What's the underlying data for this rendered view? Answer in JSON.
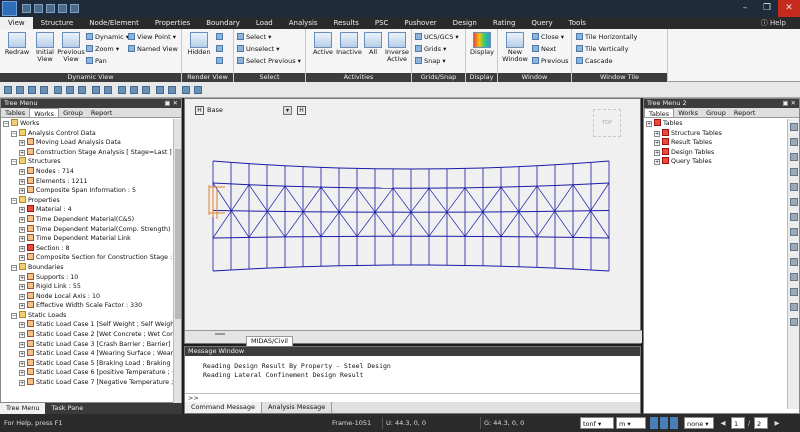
{
  "menu": {
    "tabs": [
      "View",
      "Structure",
      "Node/Element",
      "Properties",
      "Boundary",
      "Load",
      "Analysis",
      "Results",
      "PSC",
      "Pushover",
      "Design",
      "Rating",
      "Query",
      "Tools"
    ],
    "active": "View",
    "help": "Help"
  },
  "ribbon": {
    "dynamic_view": {
      "caption": "Dynamic View",
      "redraw": "Redraw",
      "initial_view": "Initial View",
      "previous_view": "Previous View",
      "dynamic": "Dynamic",
      "zoom": "Zoom",
      "pan": "Pan",
      "view_point": "View Point",
      "named_view": "Named View"
    },
    "render_view": {
      "caption": "Render View",
      "hidden": "Hidden"
    },
    "select": {
      "caption": "Select",
      "select": "Select",
      "unselect": "Unselect",
      "select_previous": "Select Previous"
    },
    "activities": {
      "caption": "Activities",
      "active": "Active",
      "inactive": "Inactive",
      "all": "All",
      "inverse_active": "Inverse Active"
    },
    "grids_snap": {
      "caption": "Grids/Snap",
      "ucs": "UCS/GCS",
      "grids": "Grids",
      "snap": "Snap"
    },
    "display": {
      "caption": "Display",
      "display": "Display"
    },
    "window": {
      "caption": "Window",
      "new_window": "New Window",
      "close": "Close",
      "next": "Next",
      "previous": "Previous"
    },
    "window_tile": {
      "caption": "Window Tile",
      "tile_h": "Tile Horizontally",
      "tile_v": "Tile Vertically",
      "cascade": "Cascade"
    }
  },
  "tree_menu": {
    "title": "Tree Menu",
    "tabs": [
      "Tables",
      "Works",
      "Group",
      "Report"
    ],
    "active_tab": "Works",
    "rows": [
      {
        "d": 0,
        "t": "Works",
        "ic": "fold"
      },
      {
        "d": 1,
        "t": "Analysis Control Data",
        "ic": "fold"
      },
      {
        "d": 2,
        "t": "Moving Load Analysis Data",
        "ic": ""
      },
      {
        "d": 2,
        "t": "Construction Stage Analysis [ Stage=Last ]",
        "ic": ""
      },
      {
        "d": 1,
        "t": "Structures",
        "ic": "fold"
      },
      {
        "d": 2,
        "t": "Nodes : 714",
        "ic": ""
      },
      {
        "d": 2,
        "t": "Elements : 1211",
        "ic": ""
      },
      {
        "d": 2,
        "t": "Composite Span Information : 5",
        "ic": ""
      },
      {
        "d": 1,
        "t": "Properties",
        "ic": "fold"
      },
      {
        "d": 2,
        "t": "Material : 4",
        "ic": "red"
      },
      {
        "d": 2,
        "t": "Time Dependent Material(C&S)",
        "ic": ""
      },
      {
        "d": 2,
        "t": "Time Dependent Material(Comp. Strength)",
        "ic": ""
      },
      {
        "d": 2,
        "t": "Time Dependent Material Link",
        "ic": ""
      },
      {
        "d": 2,
        "t": "Section : 8",
        "ic": "red"
      },
      {
        "d": 2,
        "t": "Composite Section for Construction Stage : 3",
        "ic": ""
      },
      {
        "d": 1,
        "t": "Boundaries",
        "ic": "fold"
      },
      {
        "d": 2,
        "t": "Supports : 10",
        "ic": ""
      },
      {
        "d": 2,
        "t": "Rigid Link : 55",
        "ic": ""
      },
      {
        "d": 2,
        "t": "Node Local Axis : 10",
        "ic": ""
      },
      {
        "d": 2,
        "t": "Effective Width Scale Factor : 330",
        "ic": ""
      },
      {
        "d": 1,
        "t": "Static Loads",
        "ic": "fold"
      },
      {
        "d": 2,
        "t": "Static Load Case 1 [Self Weight ; Self Weight]",
        "ic": ""
      },
      {
        "d": 2,
        "t": "Static Load Case 2 [Wet Concrete ; Wet Concr",
        "ic": ""
      },
      {
        "d": 2,
        "t": "Static Load Case 3 [Crash Barrier ; Barrier]",
        "ic": ""
      },
      {
        "d": 2,
        "t": "Static Load Case 4 [Wearing Surface ; Wearing",
        "ic": ""
      },
      {
        "d": 2,
        "t": "Static Load Case 5 [Braking Load ; Braking Lo",
        "ic": ""
      },
      {
        "d": 2,
        "t": "Static Load Case 6 [positive Temperature ; + Ve",
        "ic": ""
      },
      {
        "d": 2,
        "t": "Static Load Case 7 [Negative Temperature ; - V",
        "ic": ""
      }
    ],
    "bottom_tabs": [
      "Tree Menu",
      "Task Pane"
    ]
  },
  "tree_menu2": {
    "title": "Tree Menu 2",
    "tabs": [
      "Tables",
      "Works",
      "Group",
      "Report"
    ],
    "active_tab": "Tables",
    "rows": [
      {
        "d": 0,
        "t": "Tables",
        "ic": "red"
      },
      {
        "d": 1,
        "t": "Structure Tables",
        "ic": "red"
      },
      {
        "d": 1,
        "t": "Result Tables",
        "ic": "red"
      },
      {
        "d": 1,
        "t": "Design Tables",
        "ic": "red"
      },
      {
        "d": 1,
        "t": "Query Tables",
        "ic": "red"
      }
    ]
  },
  "viewport": {
    "view_name": "Base",
    "tab_label": "MIDAS/Civil",
    "cube_label": "TOP"
  },
  "message_window": {
    "title": "Message Window",
    "lines": [
      "Reading Design Result By Property - Steel Design",
      "Reading Lateral Confinement Design Result"
    ],
    "prompt": ">>",
    "tabs": [
      "Command Message",
      "Analysis Message"
    ]
  },
  "status": {
    "help": "For Help, press F1",
    "frame": "Frame-1051",
    "u": "U: 44.3, 0, 0",
    "g": "G: 44.3, 0, 0",
    "unit_force": "tonf",
    "unit_len": "m",
    "mode": "none",
    "page": "1",
    "pages": "2"
  }
}
